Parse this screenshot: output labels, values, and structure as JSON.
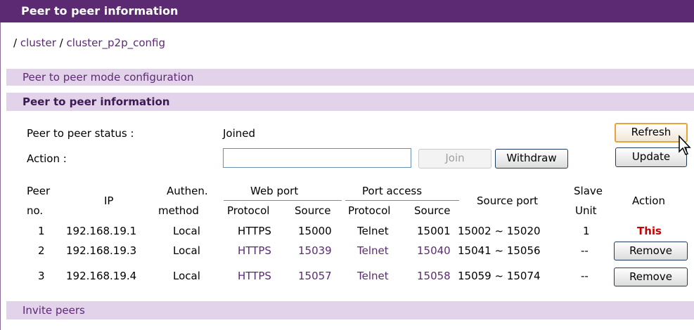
{
  "title": "Peer to peer information",
  "breadcrumb": {
    "sep1": "/",
    "item1": "cluster",
    "sep2": "/",
    "item2": "cluster_p2p_config"
  },
  "sections": {
    "mode_config": "Peer to peer mode configuration",
    "info": "Peer to peer information",
    "invite": "Invite peers"
  },
  "status": {
    "label": "Peer to peer status :",
    "value": "Joined"
  },
  "action": {
    "label": "Action :",
    "input_value": "",
    "join": "Join",
    "withdraw": "Withdraw"
  },
  "buttons": {
    "refresh": "Refresh",
    "update": "Update"
  },
  "table": {
    "headers": {
      "peer_no_1": "Peer",
      "peer_no_2": "no.",
      "ip": "IP",
      "auth_1": "Authen.",
      "auth_2": "method",
      "web_port": "Web port",
      "port_access": "Port access",
      "protocol": "Protocol",
      "source": "Source",
      "source_port": "Source port",
      "slave_1": "Slave",
      "slave_2": "Unit",
      "action": "Action"
    },
    "rows": [
      {
        "no": "1",
        "ip": "192.168.19.1",
        "auth": "Local",
        "web_protocol": "HTTPS",
        "web_source": "15000",
        "access_protocol": "Telnet",
        "access_source": "15001",
        "source_port": "15002 ~ 15020",
        "slave": "1",
        "action": "This"
      },
      {
        "no": "2",
        "ip": "192.168.19.3",
        "auth": "Local",
        "web_protocol": "HTTPS",
        "web_source": "15039",
        "access_protocol": "Telnet",
        "access_source": "15040",
        "source_port": "15041 ~ 15056",
        "slave": "--",
        "action": "Remove"
      },
      {
        "no": "3",
        "ip": "192.168.19.4",
        "auth": "Local",
        "web_protocol": "HTTPS",
        "web_source": "15057",
        "access_protocol": "Telnet",
        "access_source": "15058",
        "source_port": "15059 ~ 15074",
        "slave": "--",
        "action": "Remove"
      }
    ]
  }
}
